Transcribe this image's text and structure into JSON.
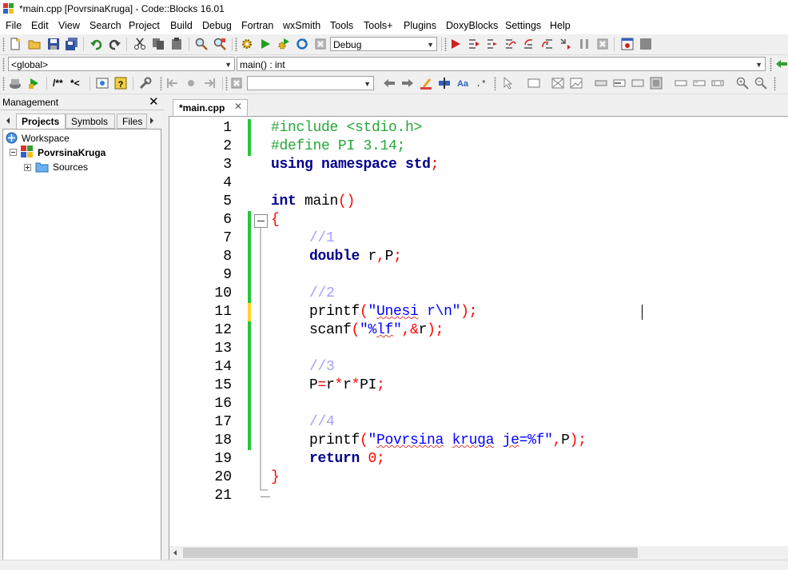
{
  "window": {
    "title": "*main.cpp [PovrsinaKruga] - Code::Blocks 16.01"
  },
  "menu": [
    "File",
    "Edit",
    "View",
    "Search",
    "Project",
    "Build",
    "Debug",
    "Fortran",
    "wxSmith",
    "Tools",
    "Tools+",
    "Plugins",
    "DoxyBlocks",
    "Settings",
    "Help"
  ],
  "toolbar": {
    "build_target": "Debug"
  },
  "codebar": {
    "scope": "<global>",
    "function": "main() : int"
  },
  "doxybar": {
    "comment_block": "/**",
    "comment_line": "*<",
    "search_value": ""
  },
  "management": {
    "title": "Management",
    "tabs": [
      "Projects",
      "Symbols",
      "Files"
    ],
    "tree": {
      "workspace": "Workspace",
      "project": "PovrsinaKruga",
      "folder": "Sources"
    }
  },
  "editor": {
    "tab_label": "*main.cpp",
    "line_numbers": [
      "1",
      "2",
      "3",
      "4",
      "5",
      "6",
      "7",
      "8",
      "9",
      "10",
      "11",
      "12",
      "13",
      "14",
      "15",
      "16",
      "17",
      "18",
      "19",
      "20",
      "21"
    ],
    "lines": {
      "l1": "#include <stdio.h>",
      "l2": "#define PI 3.14;",
      "l3a": "using",
      "l3b": "namespace",
      "l3c": "std",
      "l3d": ";",
      "l5a": "int",
      "l5b": "main",
      "l5c": "()",
      "l6": "{",
      "l7": "//1",
      "l8a": "double",
      "l8b": "r",
      "l8c": ",",
      "l8d": "P",
      "l8e": ";",
      "l10": "//2",
      "l11a": "printf",
      "l11b": "(",
      "l11c": "\"",
      "l11d": "Unesi",
      "l11e": " r\\n\"",
      "l11f": ");",
      "l12a": "scanf",
      "l12b": "(",
      "l12c": "\"%",
      "l12d": "lf",
      "l12e": "\"",
      "l12f": ",&",
      "l12g": "r",
      "l12h": ");",
      "l14": "//3",
      "l15a": "P",
      "l15b": "=",
      "l15c": "r",
      "l15d": "*",
      "l15e": "r",
      "l15f": "*",
      "l15g": "PI",
      "l15h": ";",
      "l17": "//4",
      "l18a": "printf",
      "l18b": "(",
      "l18c": "\"",
      "l18d": "Povrsina",
      "l18e": " ",
      "l18f": "kruga",
      "l18g": " ",
      "l18h": "je",
      "l18i": "=%f\"",
      "l18j": ",",
      "l18k": "P",
      "l18l": ");",
      "l19a": "return",
      "l19b": " ",
      "l19c": "0",
      "l19d": ";",
      "l20": "}"
    }
  },
  "colors": {
    "preprocessor": "#26a63a",
    "keyword": "#00008b",
    "comment": "#a0a0ff",
    "string": "#0000ff",
    "operator": "#ff0000",
    "change_bar": "#27c43b",
    "unsaved_bar": "#ffd42a"
  }
}
